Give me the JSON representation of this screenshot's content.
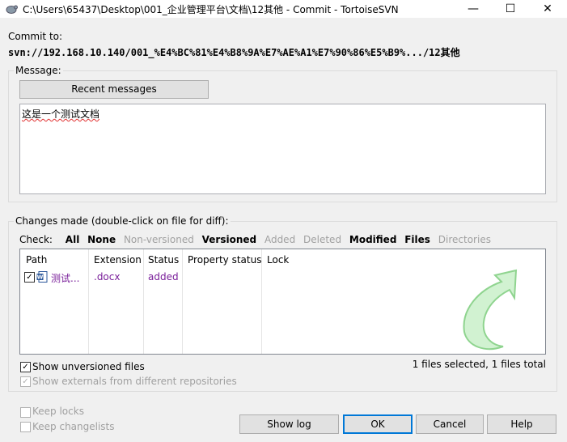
{
  "window": {
    "title": "C:\\Users\\65437\\Desktop\\001_企业管理平台\\文档\\12其他 - Commit - TortoiseSVN",
    "minimize_glyph": "—",
    "maximize_glyph": "☐",
    "close_glyph": "✕"
  },
  "commit_to": {
    "label": "Commit to:",
    "url": "svn://192.168.10.140/001_%E4%BC%81%E4%B8%9A%E7%AE%A1%E7%90%86%E5%B9%.../12其他"
  },
  "message": {
    "group_label": "Message:",
    "recent_button": "Recent messages",
    "text": "这是一个测试文档"
  },
  "changes": {
    "group_label": "Changes made (double-click on file for diff):",
    "check_label": "Check:",
    "check_links": {
      "all": "All",
      "none": "None",
      "non_versioned": "Non-versioned",
      "versioned": "Versioned",
      "added": "Added",
      "deleted": "Deleted",
      "modified": "Modified",
      "files": "Files",
      "directories": "Directories"
    },
    "columns": {
      "path": "Path",
      "extension": "Extension",
      "status": "Status",
      "property_status": "Property status",
      "lock": "Lock"
    },
    "rows": [
      {
        "checked": true,
        "icon": "word-doc-icon",
        "path": "测试...",
        "extension": ".docx",
        "status": "added"
      }
    ],
    "show_unversioned": "Show unversioned files",
    "show_externals": "Show externals from different repositories",
    "summary": "1 files selected, 1 files total"
  },
  "options": {
    "keep_locks": "Keep locks",
    "keep_changelists": "Keep changelists"
  },
  "buttons": {
    "show_log": "Show log",
    "ok": "OK",
    "cancel": "Cancel",
    "help": "Help"
  },
  "colors": {
    "accent": "#0078d7",
    "added_status": "#7a1f9a",
    "disabled_text": "#a0a0a0"
  }
}
